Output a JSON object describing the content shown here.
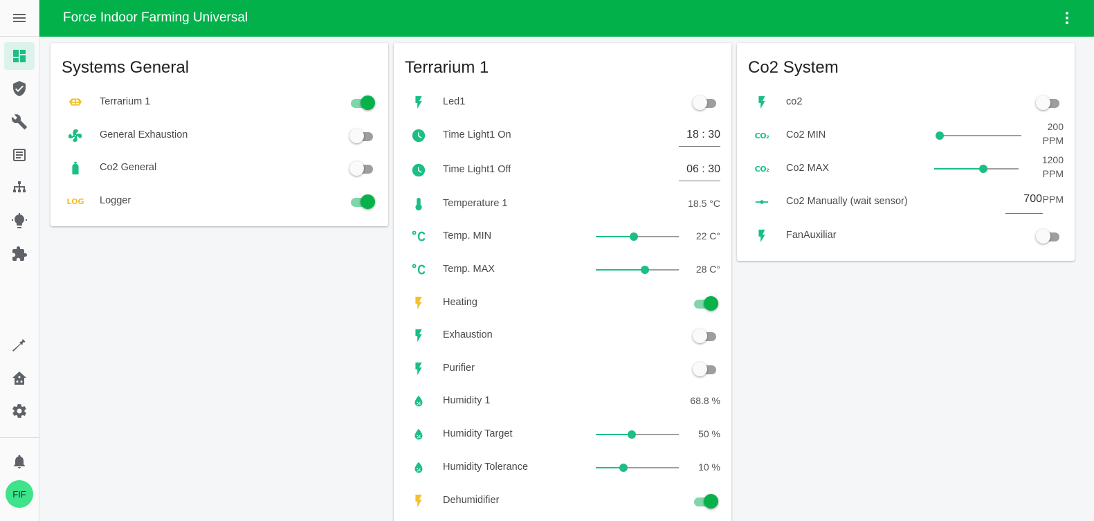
{
  "app": {
    "title": "Force Indoor Farming Universal"
  },
  "user": {
    "initials": "FIF"
  },
  "colors": {
    "primary": "#03b14b",
    "accent": "#1bbf83",
    "warning": "#f2c12b"
  },
  "sidebar": {
    "icons": [
      "menu-icon",
      "dashboard-icon",
      "shield-check-icon",
      "wrench-icon",
      "logbook-icon",
      "hierarchy-icon",
      "lightbulb-icon",
      "puzzle-icon",
      "hammer-icon",
      "home-assistant-icon",
      "settings-icon",
      "bell-icon"
    ]
  },
  "cards": {
    "systems": {
      "title": "Systems General",
      "rows": [
        {
          "label": "Terrarium 1",
          "icon": "terrarium-icon",
          "on": true
        },
        {
          "label": "General Exhaustion",
          "icon": "fan-icon",
          "on": false
        },
        {
          "label": "Co2 General",
          "icon": "gas-cylinder-icon",
          "on": false
        },
        {
          "label": "Logger",
          "icon": "log-icon",
          "icon_text": "LOG",
          "on": true
        }
      ]
    },
    "terrarium": {
      "title": "Terrarium 1",
      "rows": [
        {
          "label": "Led1",
          "icon": "flash-icon",
          "on": false
        },
        {
          "label": "Time Light1 On",
          "icon": "clock-icon",
          "value": "18 : 30"
        },
        {
          "label": "Time Light1 Off",
          "icon": "clock-icon",
          "value": "06 : 30"
        },
        {
          "label": "Temperature 1",
          "icon": "thermometer-icon",
          "value": "18.5 °C"
        },
        {
          "label": "Temp. MIN",
          "icon": "celsius-icon",
          "value": "22 C°",
          "level": 0.46
        },
        {
          "label": "Temp. MAX",
          "icon": "celsius-icon",
          "value": "28 C°",
          "level": 0.59
        },
        {
          "label": "Heating",
          "icon": "flash-icon",
          "on": true
        },
        {
          "label": "Exhaustion",
          "icon": "flash-icon",
          "on": false
        },
        {
          "label": "Purifier",
          "icon": "flash-icon",
          "on": false
        },
        {
          "label": "Humidity 1",
          "icon": "water-percent-icon",
          "value": "68.8 %"
        },
        {
          "label": "Humidity Target",
          "icon": "water-percent-icon",
          "value": "50 %",
          "level": 0.43
        },
        {
          "label": "Humidity Tolerance",
          "icon": "water-percent-icon",
          "value": "10 %",
          "level": 0.33
        },
        {
          "label": "Dehumidifier",
          "icon": "flash-icon",
          "on": true
        }
      ]
    },
    "co2": {
      "title": "Co2 System",
      "rows": [
        {
          "label": "co2",
          "icon": "flash-icon",
          "on": false
        },
        {
          "label": "Co2 MIN",
          "icon": "co2-icon",
          "icon_text": "CO₂",
          "value": "200",
          "unit": "PPM",
          "level": 0.0
        },
        {
          "label": "Co2 MAX",
          "icon": "co2-icon",
          "icon_text": "CO₂",
          "value": "1200",
          "unit": "PPM",
          "level": 0.58
        },
        {
          "label": "Co2 Manually (wait sensor)",
          "icon": "commit-icon",
          "value": "700",
          "unit": "PPM"
        },
        {
          "label": "FanAuxiliar",
          "icon": "flash-icon",
          "on": false
        }
      ]
    }
  }
}
